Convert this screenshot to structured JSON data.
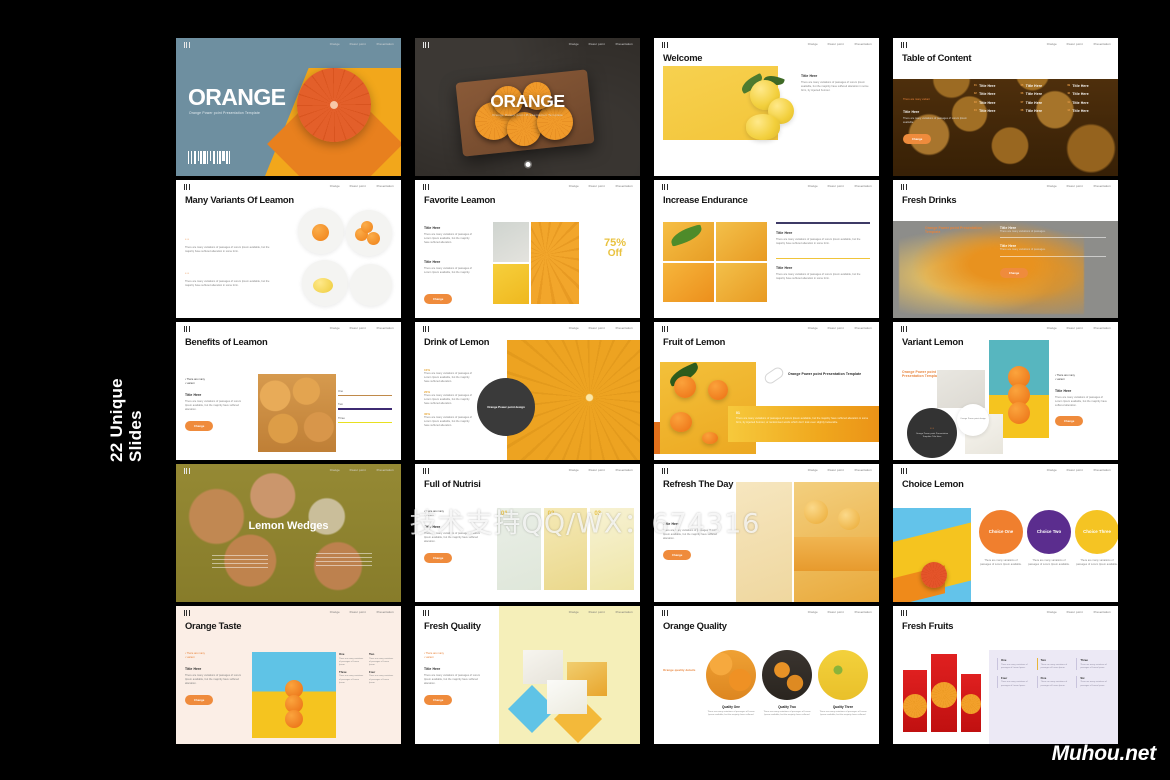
{
  "page": {
    "side_label": "22 Unique\nSlides",
    "watermark": "技术支持QQ/WX：674316",
    "site_logo": "Muhou.net"
  },
  "nav": {
    "item1": "Orange",
    "item2": "Power point",
    "item3": "Presentation"
  },
  "common": {
    "lorem_short": "There are many variations of passages of Lorem Ipsum available, but the majority have suffered alteration in some form, by injected.",
    "lorem_tiny": "There are many variations of passages of Lorem Ipsum available.",
    "title_here": "Title Here",
    "there_are_many": "There are many",
    "variant": "variant",
    "button": "Change",
    "tagline": "Orange Power point Presentation Template"
  },
  "slides": [
    {
      "n": 1,
      "name": "orange-cover-blue",
      "title": "ORANGE",
      "subtitle": "Orange Power point Presentation Template"
    },
    {
      "n": 2,
      "name": "orange-cover-dark",
      "title": "ORANGE",
      "subtitle": "Orange Power point Presentation Template"
    },
    {
      "n": 3,
      "name": "welcome",
      "title": "Welcome",
      "heading": "Title Here",
      "body": "There are many variations of passages of Lorem Ipsum available, but the majority have suffered alteration in some form, by injected humour."
    },
    {
      "n": 4,
      "name": "table-of-content",
      "title": "Table of Content",
      "lead": "There are many variant",
      "heading": "Title Here",
      "body": "There are many variations of passages of Lorem Ipsum available.",
      "button": "Change",
      "items": [
        "Title Here",
        "Title Here",
        "Title Here",
        "Title Here",
        "Title Here",
        "Title Here",
        "Title Here",
        "Title Here",
        "Title Here",
        "Title Here",
        "Title Here",
        "Title Here"
      ]
    },
    {
      "n": 5,
      "name": "many-variants-of-leamon",
      "title": "Many Variants Of Leamon",
      "block1_heading": "Title Here",
      "block1_body": "There are many variations of passages of Lorem Ipsum available, but the majority have suffered alteration in some form.",
      "block2_heading": "Title Here",
      "block2_body": "There are many variations of passages of Lorem Ipsum available, but the majority have suffered alteration in some form."
    },
    {
      "n": 6,
      "name": "favorite-leamon",
      "title": "Favorite Leamon",
      "block1_heading": "Title Here",
      "block1_body": "There are many variations of passages of Lorem Ipsum available, but the majority have suffered alteration.",
      "block2_heading": "Title Here",
      "block2_body": "There are many variations of passages of Lorem Ipsum available, but the majority.",
      "discount_value": "75%",
      "discount_label": "Off",
      "button": "Change"
    },
    {
      "n": 7,
      "name": "increase-endurance",
      "title": "Increase Endurance",
      "block1_heading": "Title Here",
      "block1_body": "There are many variations of passages of Lorem Ipsum available, but the majority have suffered alteration in some form.",
      "block2_heading": "Title Here",
      "block2_body": "There are many variations of passages of Lorem Ipsum available, but the majority have suffered alteration in some form."
    },
    {
      "n": 8,
      "name": "fresh-drinks",
      "title": "Fresh Drinks",
      "tagline": "Orange Power point Presentation Template",
      "block1_heading": "Title Here",
      "block1_body": "There are many variations of passages.",
      "block2_heading": "Title Here",
      "block2_body": "There are many variations of passages.",
      "button": "Change"
    },
    {
      "n": 9,
      "name": "benefits-of-leamon",
      "title": "Benefits of Leamon",
      "bullet1": "There are many",
      "bullet2": "variant",
      "heading": "Title Here",
      "body": "There are many variations of passages of Lorem Ipsum available, but the majority have suffered alteration.",
      "button": "Change",
      "bars": [
        {
          "label": "One",
          "color": "#c08a4a"
        },
        {
          "label": "Two",
          "color": "#3e2b73"
        },
        {
          "label": "Three",
          "color": "#e8e020"
        }
      ]
    },
    {
      "n": 10,
      "name": "drink-of-lemon",
      "title": "Drink of Lemon",
      "circle_text": "Orange Power point design",
      "items": [
        {
          "num": "10%",
          "body": "There are many variations of passages of Lorem Ipsum available, but the majority have suffered alteration."
        },
        {
          "num": "20%",
          "body": "There are many variations of passages of Lorem Ipsum available, but the majority have suffered alteration."
        },
        {
          "num": "30%",
          "body": "There are many variations of passages of Lorem Ipsum available, but the majority have suffered alteration."
        }
      ]
    },
    {
      "n": 11,
      "name": "fruit-of-lemon",
      "title": "Fruit of Lemon",
      "tagline": "Orange Power point Presentation Template",
      "band_heading": "01",
      "band_body": "There are many variations of passages of Lorem Ipsum available, but the majority have suffered alteration in some form, by injected humour, or randomised words which don't look even slightly believable."
    },
    {
      "n": 12,
      "name": "variant-lemon",
      "title": "Variant Lemon",
      "tagline": "Orange Power point Presentation Template",
      "dark_circle_text": "Orange Power point Presentation Template Title Here",
      "white_circle_text": "Orange Power point design",
      "bullet1": "There are many",
      "bullet2": "variant",
      "heading": "Title Here",
      "body": "There are many variations of passages of Lorem Ipsum available, but the majority have suffered alteration.",
      "button": "Change"
    },
    {
      "n": 13,
      "name": "lemon-wedges",
      "title": "Lemon Wedges",
      "body_left": "There are many variations of passages of Lorem Ipsum available.",
      "body_right": "There are many variations of passages of Lorem Ipsum available."
    },
    {
      "n": 14,
      "name": "full-of-nutrisi",
      "title": "Full of Nutrisi",
      "bullet1": "There are many",
      "bullet2": "variant",
      "heading": "Title Here",
      "body": "There are many variations of passages of Lorem Ipsum available, but the majority have suffered alteration.",
      "button": "Change",
      "numbers": [
        "01",
        "02",
        "03"
      ]
    },
    {
      "n": 15,
      "name": "refresh-the-day",
      "title": "Refresh The Day",
      "heading": "Title Here",
      "body": "There are many variations of passages of Lorem Ipsum available, but the majority have suffered alteration.",
      "button": "Change"
    },
    {
      "n": 16,
      "name": "choice-lemon",
      "title": "Choice Lemon",
      "choices": [
        {
          "label": "Choice One",
          "color": "#f07f2e",
          "body": "There are many variations of passages of Lorem Ipsum available."
        },
        {
          "label": "Choice Two",
          "color": "#5b2d8e",
          "body": "There are many variations of passages of Lorem Ipsum available."
        },
        {
          "label": "Choice Three",
          "color": "#f5c423",
          "body": "There are many variations of passages of Lorem Ipsum available."
        }
      ]
    },
    {
      "n": 17,
      "name": "orange-taste",
      "title": "Orange Taste",
      "bullet1": "There are many",
      "bullet2": "variant",
      "heading": "Title Here",
      "body": "There are many variations of passages of Lorem Ipsum available, but the majority have suffered alteration.",
      "button": "Change",
      "cells": [
        {
          "h": "One",
          "p": "There are many variations of passages of Lorem Ipsum."
        },
        {
          "h": "Two",
          "p": "There are many variations of passages of Lorem Ipsum."
        },
        {
          "h": "Three",
          "p": "There are many variations of passages of Lorem Ipsum."
        },
        {
          "h": "Four",
          "p": "There are many variations of passages of Lorem Ipsum."
        }
      ]
    },
    {
      "n": 18,
      "name": "fresh-quality",
      "title": "Fresh Quality",
      "bullet1": "There are many",
      "bullet2": "variant",
      "heading": "Title Here",
      "body": "There are many variations of passages of Lorem Ipsum available, but the majority have suffered alteration.",
      "button": "Change"
    },
    {
      "n": 19,
      "name": "orange-quality",
      "title": "Orange Quality",
      "lead": "Orange quality details",
      "qualities": [
        {
          "label": "Quality One",
          "body": "There are many variations of passages of Lorem Ipsum available, but the majority have suffered."
        },
        {
          "label": "Quality Two",
          "body": "There are many variations of passages of Lorem Ipsum available, but the majority have suffered."
        },
        {
          "label": "Quality Three",
          "body": "There are many variations of passages of Lorem Ipsum available, but the majority have suffered."
        }
      ]
    },
    {
      "n": 20,
      "name": "fresh-fruits",
      "title": "Fresh Fruits",
      "cells": [
        {
          "h": "One",
          "p": "There are many variations of passages of Lorem Ipsum."
        },
        {
          "h": "Two",
          "p": "There are many variations of passages of Lorem Ipsum."
        },
        {
          "h": "Three",
          "p": "There are many variations of passages of Lorem Ipsum."
        },
        {
          "h": "Four",
          "p": "There are many variations of passages of Lorem Ipsum."
        },
        {
          "h": "Five",
          "p": "There are many variations of passages of Lorem Ipsum."
        },
        {
          "h": "Six",
          "p": "There are many variations of passages of Lorem Ipsum."
        }
      ]
    }
  ]
}
